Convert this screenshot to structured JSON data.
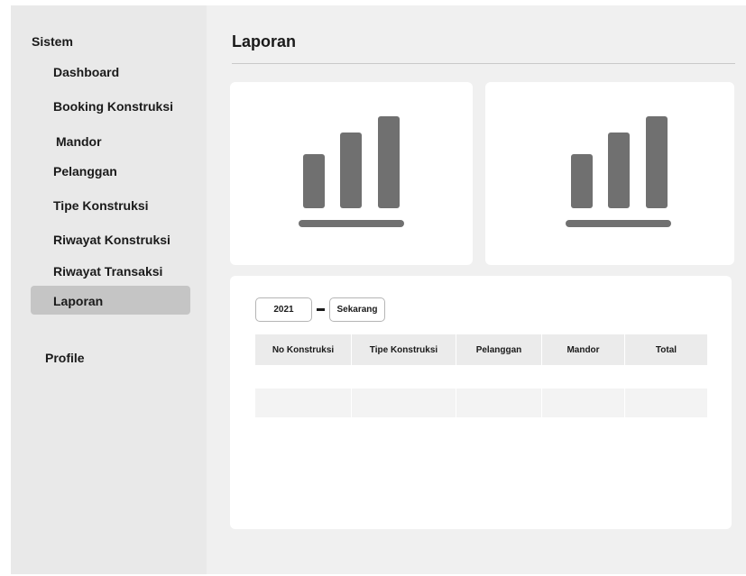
{
  "sidebar": {
    "section_title": "Sistem",
    "items": [
      {
        "label": "Dashboard"
      },
      {
        "label": "Booking Konstruksi"
      },
      {
        "label": "Mandor"
      },
      {
        "label": "Pelanggan"
      },
      {
        "label": "Tipe Konstruksi"
      },
      {
        "label": "Riwayat Konstruksi"
      },
      {
        "label": "Riwayat Transaksi"
      },
      {
        "label": "Laporan",
        "active": true
      }
    ],
    "profile_label": "Profile"
  },
  "main": {
    "title": "Laporan",
    "filter": {
      "from_year": "2021",
      "to_label": "Sekarang"
    },
    "table": {
      "headers": [
        "No Konstruksi",
        "Tipe Konstruksi",
        "Pelanggan",
        "Mandor",
        "Total"
      ],
      "rows": [
        [
          "",
          "",
          "",
          "",
          ""
        ]
      ]
    }
  },
  "icons": {
    "chart_icon_1": "bar-chart-icon",
    "chart_icon_2": "bar-chart-icon"
  },
  "colors": {
    "sidebar_bg": "#e9e9e9",
    "active_item_bg": "#c5c5c5",
    "main_bg": "#f0f0f0",
    "icon_color": "#707070"
  }
}
